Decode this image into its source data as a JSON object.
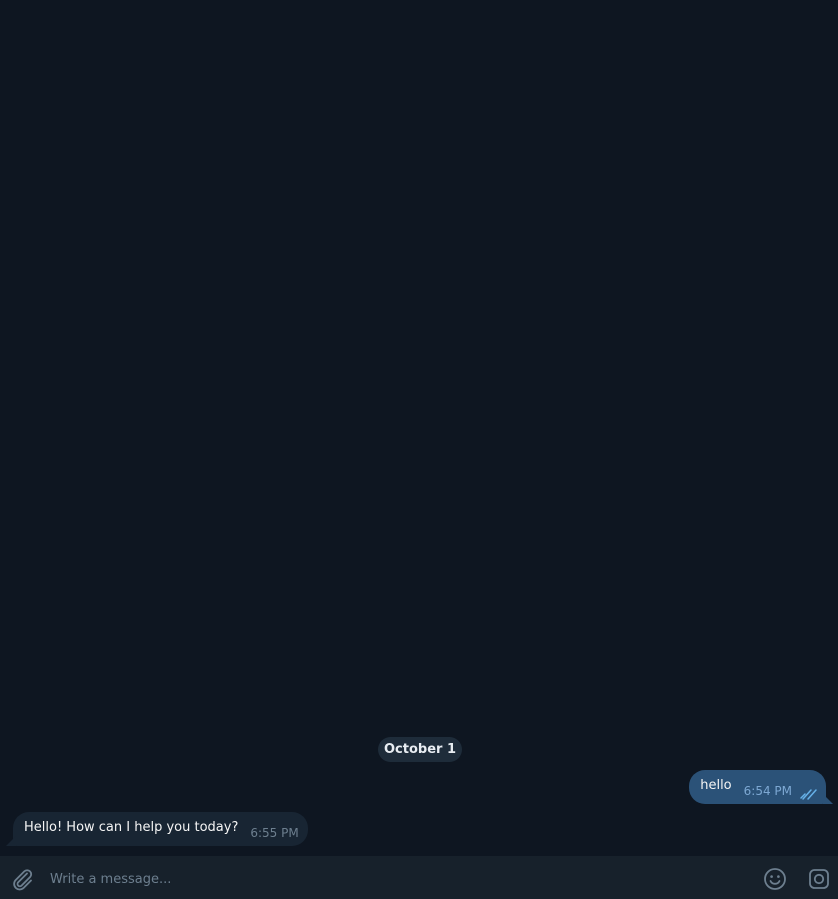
{
  "chat": {
    "date_separator": "October 1",
    "messages": [
      {
        "direction": "outgoing",
        "text": "hello",
        "time": "6:54 PM",
        "status": "read"
      },
      {
        "direction": "incoming",
        "text": "Hello! How can I help you today?",
        "time": "6:55 PM"
      }
    ]
  },
  "composer": {
    "placeholder": "Write a message...",
    "value": "",
    "icons": {
      "attach": "paperclip-icon",
      "emoji": "smiley-icon",
      "bot_commands": "bot-command-icon"
    }
  },
  "colors": {
    "background": "#0e1621",
    "outgoing_bubble": "#2b5278",
    "incoming_bubble": "#182533",
    "composer_bg": "#17212b",
    "read_check": "#66b1e8"
  }
}
